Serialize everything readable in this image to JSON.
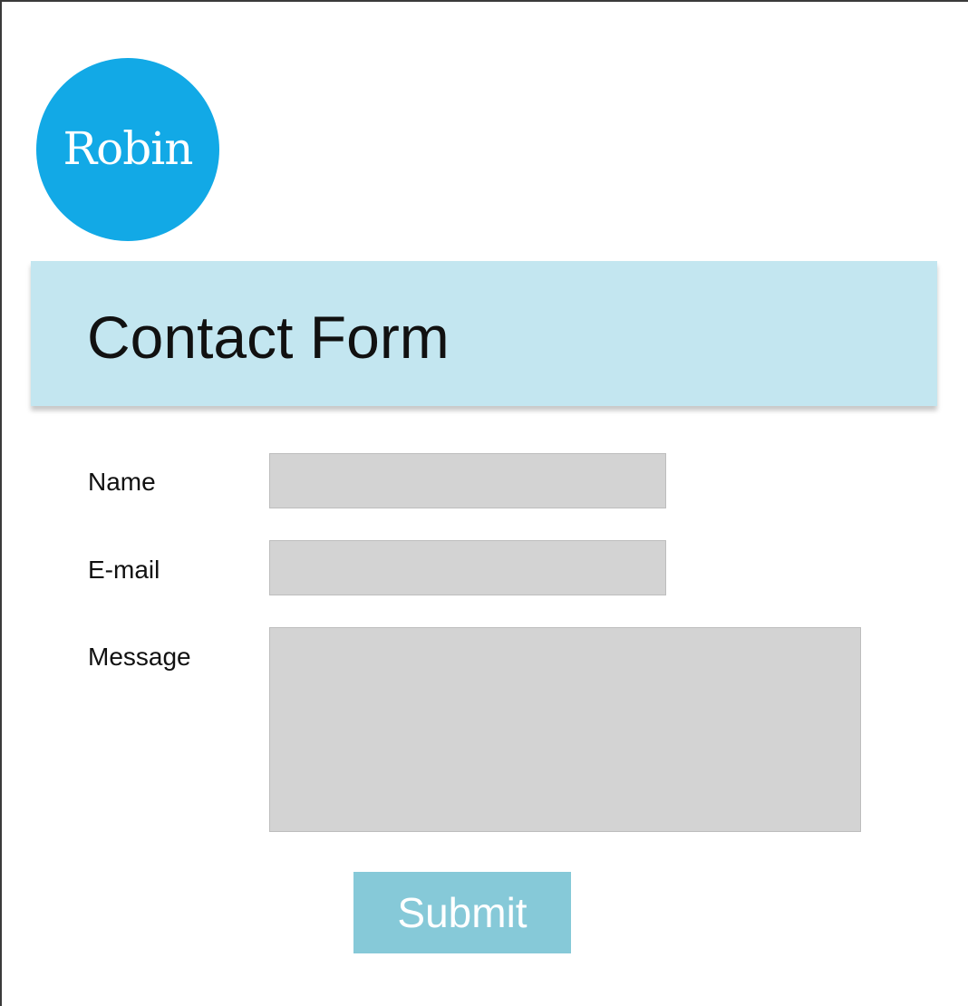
{
  "logo": {
    "text": "Robin",
    "color": "#12a9e6"
  },
  "header": {
    "title": "Contact Form",
    "background": "#c3e6f0"
  },
  "form": {
    "fields": [
      {
        "label": "Name",
        "value": ""
      },
      {
        "label": "E-mail",
        "value": ""
      },
      {
        "label": "Message",
        "value": ""
      }
    ],
    "submit_label": "Submit",
    "submit_color": "#86c9d8"
  }
}
